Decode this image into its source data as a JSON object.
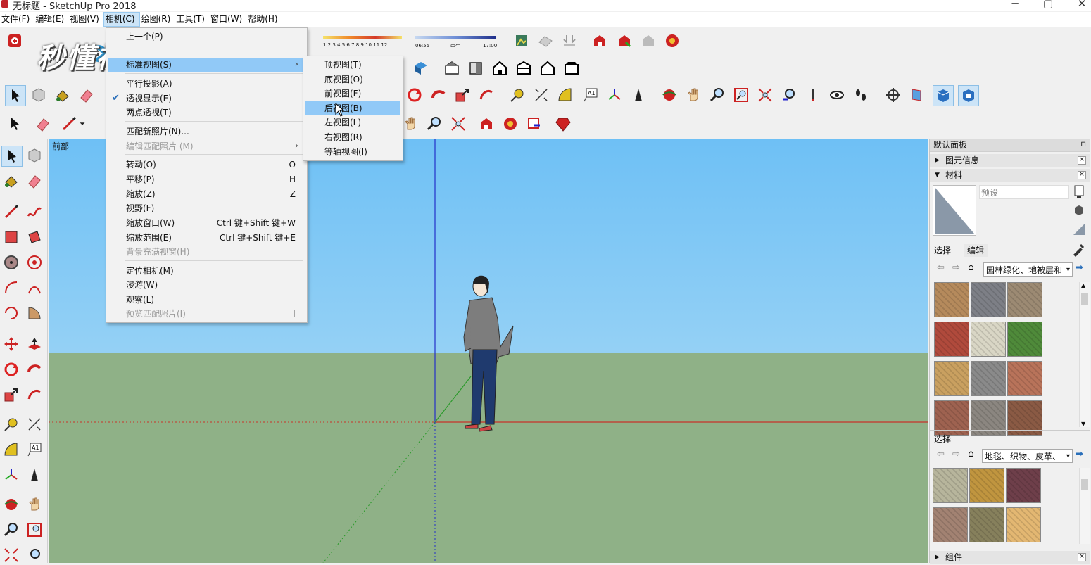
{
  "window": {
    "title": "无标题 - SketchUp Pro 2018",
    "minimize": "─",
    "maximize": "▢",
    "close": "✕"
  },
  "menubar": {
    "items": [
      "文件(F)",
      "编辑(E)",
      "视图(V)",
      "相机(C)",
      "绘图(R)",
      "工具(T)",
      "窗口(W)",
      "帮助(H)"
    ],
    "active_index": 3
  },
  "watermark": {
    "text": "秒懂视频"
  },
  "shadow_bar": {
    "months": "1 2 3 4 5 6 7 8 9 10 11 12",
    "time_start": "06:55",
    "time_mid": "中午",
    "time_end": "17:00"
  },
  "camera_menu": {
    "items": [
      {
        "label": "上一个(P)",
        "shortcut": "",
        "disabled": false
      },
      {
        "label": "标准视图(S)",
        "shortcut": "",
        "disabled": false,
        "submenu": true,
        "highlight": true
      },
      {
        "label": "平行投影(A)",
        "shortcut": "",
        "disabled": false
      },
      {
        "label": "透视显示(E)",
        "shortcut": "",
        "disabled": false,
        "checked": true
      },
      {
        "label": "两点透视(T)",
        "shortcut": "",
        "disabled": false
      },
      {
        "label": "匹配新照片(N)...",
        "shortcut": "",
        "disabled": false
      },
      {
        "label": "编辑匹配照片 (M)",
        "shortcut": "",
        "disabled": true,
        "submenu": true
      },
      {
        "label": "转动(O)",
        "shortcut": "O",
        "disabled": false
      },
      {
        "label": "平移(P)",
        "shortcut": "H",
        "disabled": false
      },
      {
        "label": "缩放(Z)",
        "shortcut": "Z",
        "disabled": false
      },
      {
        "label": "视野(F)",
        "shortcut": "",
        "disabled": false
      },
      {
        "label": "缩放窗口(W)",
        "shortcut": "Ctrl 键+Shift 键+W",
        "disabled": false
      },
      {
        "label": "缩放范围(E)",
        "shortcut": "Ctrl 键+Shift 键+E",
        "disabled": false
      },
      {
        "label": "背景充满视窗(H)",
        "shortcut": "",
        "disabled": true
      },
      {
        "label": "定位相机(M)",
        "shortcut": "",
        "disabled": false
      },
      {
        "label": "漫游(W)",
        "shortcut": "",
        "disabled": false
      },
      {
        "label": "观察(L)",
        "shortcut": "",
        "disabled": false
      },
      {
        "label": "预览匹配照片(I)",
        "shortcut": "I",
        "disabled": true
      }
    ]
  },
  "standard_views_submenu": {
    "items": [
      "顶视图(T)",
      "底视图(O)",
      "前视图(F)",
      "后视图(B)",
      "左视图(L)",
      "右视图(R)",
      "等轴视图(I)"
    ],
    "highlight_index": 3
  },
  "viewport": {
    "scene_tab": "前部"
  },
  "right_panel": {
    "tray_title": "默认面板",
    "entity_info": "图元信息",
    "materials": "材料",
    "material_name_placeholder": "预设",
    "tab_select": "选择",
    "tab_edit": "编辑",
    "library_top": "园林绿化、地被层和",
    "select_label": "选择",
    "library_bottom": "地毯、织物、皮革、",
    "components": "组件",
    "swatches_top": [
      "#b58a5c",
      "#7d7f86",
      "#9c8a73",
      "#b04a3c",
      "#d9d6c5",
      "#4f8a3a",
      "#c9a060",
      "#8a8a8a",
      "#b8735a",
      "#9e6250",
      "#8b8680",
      "#8a5a44"
    ],
    "swatches_bottom": [
      "#b7b59c",
      "#c0953f",
      "#6e3f4a",
      "#a28272",
      "#86805c",
      "#e3b772"
    ]
  },
  "colors": {
    "sky_top": "#6ec0f5",
    "ground": "#8fb187",
    "menu_highlight": "#91c9f7",
    "axis_red": "#c8322a",
    "axis_green": "#2b9a2b",
    "axis_blue": "#2330c8"
  }
}
